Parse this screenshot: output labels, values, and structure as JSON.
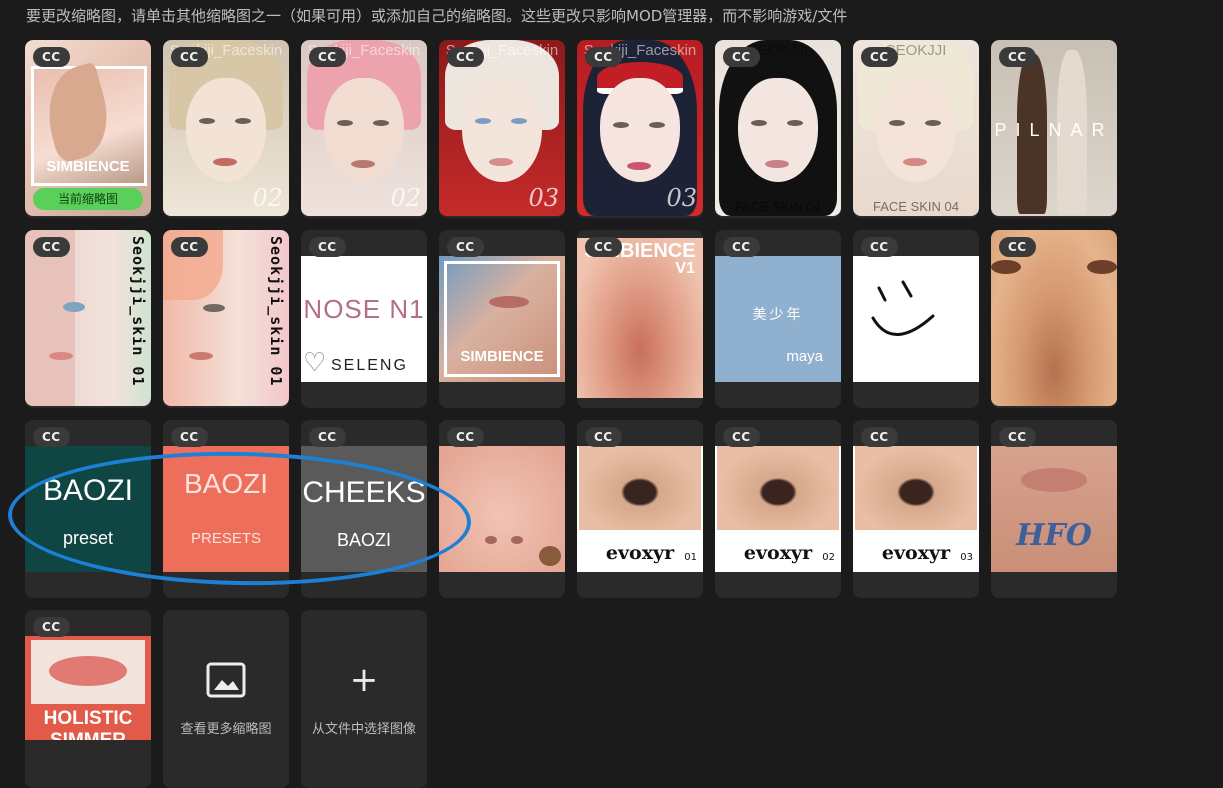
{
  "hint": "要更改缩略图，请单击其他缩略图之一（如果可用）或添加自己的缩略图。这些更改只影响MOD管理器，而不影响游戏/文件",
  "colors": {
    "current_badge": "#58d05a",
    "annotation": "#1d7fd6"
  },
  "tiles": [
    {
      "badge": "CC",
      "current_label": "当前缩略图",
      "text": "SIMBIENCE"
    },
    {
      "badge": "CC",
      "top_text": "Seokjji_Faceskin",
      "num": "02"
    },
    {
      "badge": "CC",
      "top_text": "Seokjji_Faceskin",
      "num": "02"
    },
    {
      "badge": "CC",
      "top_text": "Seokjji_Faceskin",
      "num": "03"
    },
    {
      "badge": "CC",
      "top_text": "Seokjji_Faceskin",
      "num": "03"
    },
    {
      "badge": "CC",
      "top_text": "SEOKJJI",
      "bottom_text": "FACE SKIN 04"
    },
    {
      "badge": "CC",
      "top_text": "SEOKJJI",
      "bottom_text": "FACE SKIN 04"
    },
    {
      "badge": "CC",
      "text": "PILNAR"
    },
    {
      "badge": "CC",
      "side_text": "Seokjji_skin 01"
    },
    {
      "badge": "CC",
      "side_text": "Seokjji_skin 01"
    },
    {
      "badge": "CC",
      "text": "NOSE N1",
      "sub": "SELENG"
    },
    {
      "badge": "CC",
      "text": "SIMBIENCE"
    },
    {
      "badge": "CC",
      "text": "SIMBIENCE",
      "sub": "V1"
    },
    {
      "badge": "CC",
      "text": "美少年",
      "sub": "maya"
    },
    {
      "badge": "CC"
    },
    {
      "badge": "CC"
    },
    {
      "badge": "CC",
      "text": "BAOZI",
      "sub": "preset"
    },
    {
      "badge": "CC",
      "text": "BAOZI",
      "sub": "PRESETS"
    },
    {
      "badge": "CC",
      "text": "CHEEKS",
      "sub": "BAOZI"
    },
    {
      "badge": "CC"
    },
    {
      "badge": "CC",
      "text": "evoxyr",
      "sub": "01"
    },
    {
      "badge": "CC",
      "text": "evoxyr",
      "sub": "02"
    },
    {
      "badge": "CC",
      "text": "evoxyr",
      "sub": "03"
    },
    {
      "badge": "CC",
      "text": "HFO"
    },
    {
      "badge": "CC",
      "text": "HOLISTIC",
      "sub": "SIMMER"
    }
  ],
  "actions": {
    "more": "查看更多缩略图",
    "from_file": "从文件中选择图像",
    "from_file_icon": "+"
  }
}
